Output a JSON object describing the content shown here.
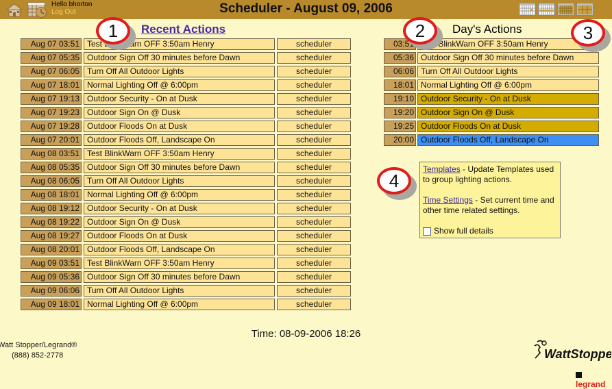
{
  "header": {
    "title": "Scheduler - August 09, 2006",
    "greeting": "Hello bhorton",
    "logout_label": "Log Out",
    "view_buttons": [
      "day-view",
      "week-view",
      "month-view",
      "year-view"
    ]
  },
  "recent": {
    "title": "Recent Actions",
    "rows": [
      {
        "date": "Aug 07 03:51",
        "action": "Test BlinkWarn OFF 3:50am Henry",
        "user": "scheduler"
      },
      {
        "date": "Aug 07 05:35",
        "action": "Outdoor Sign Off 30 minutes before Dawn",
        "user": "scheduler"
      },
      {
        "date": "Aug 07 06:05",
        "action": "Turn Off All Outdoor Lights",
        "user": "scheduler"
      },
      {
        "date": "Aug 07 18:01",
        "action": "Normal Lighting Off @ 6:00pm",
        "user": "scheduler"
      },
      {
        "date": "Aug 07 19:13",
        "action": "Outdoor Security - On at Dusk",
        "user": "scheduler"
      },
      {
        "date": "Aug 07 19:23",
        "action": "Outdoor Sign On @ Dusk",
        "user": "scheduler"
      },
      {
        "date": "Aug 07 19:28",
        "action": "Outdoor Floods On at Dusk",
        "user": "scheduler"
      },
      {
        "date": "Aug 07 20:01",
        "action": "Outdoor Floods Off, Landscape On",
        "user": "scheduler"
      },
      {
        "date": "Aug 08 03:51",
        "action": "Test BlinkWarn OFF 3:50am Henry",
        "user": "scheduler"
      },
      {
        "date": "Aug 08 05:35",
        "action": "Outdoor Sign Off 30 minutes before Dawn",
        "user": "scheduler"
      },
      {
        "date": "Aug 08 06:05",
        "action": "Turn Off All Outdoor Lights",
        "user": "scheduler"
      },
      {
        "date": "Aug 08 18:01",
        "action": "Normal Lighting Off @ 6:00pm",
        "user": "scheduler"
      },
      {
        "date": "Aug 08 19:12",
        "action": "Outdoor Security - On at Dusk",
        "user": "scheduler"
      },
      {
        "date": "Aug 08 19:22",
        "action": "Outdoor Sign On @ Dusk",
        "user": "scheduler"
      },
      {
        "date": "Aug 08 19:27",
        "action": "Outdoor Floods On at Dusk",
        "user": "scheduler"
      },
      {
        "date": "Aug 08 20:01",
        "action": "Outdoor Floods Off, Landscape On",
        "user": "scheduler"
      },
      {
        "date": "Aug 09 03:51",
        "action": "Test BlinkWarn OFF 3:50am Henry",
        "user": "scheduler"
      },
      {
        "date": "Aug 09 05:36",
        "action": "Outdoor Sign Off 30 minutes before Dawn",
        "user": "scheduler"
      },
      {
        "date": "Aug 09 06:06",
        "action": "Turn Off All Outdoor Lights",
        "user": "scheduler"
      },
      {
        "date": "Aug 09 18:01",
        "action": "Normal Lighting Off @ 6:00pm",
        "user": "scheduler"
      }
    ]
  },
  "day": {
    "title": "Day's Actions",
    "rows": [
      {
        "time": "03:51",
        "action": "Test BlinkWarn OFF 3:50am Henry",
        "status": "past"
      },
      {
        "time": "05:36",
        "action": "Outdoor Sign Off 30 minutes before Dawn",
        "status": "past"
      },
      {
        "time": "06:06",
        "action": "Turn Off All Outdoor Lights",
        "status": "past"
      },
      {
        "time": "18:01",
        "action": "Normal Lighting Off @ 6:00pm",
        "status": "past"
      },
      {
        "time": "19:10",
        "action": "Outdoor Security - On at Dusk",
        "status": "upcoming"
      },
      {
        "time": "19:20",
        "action": "Outdoor Sign On @ Dusk",
        "status": "upcoming"
      },
      {
        "time": "19:25",
        "action": "Outdoor Floods On at Dusk",
        "status": "upcoming"
      },
      {
        "time": "20:00",
        "action": "Outdoor Floods Off, Landscape On",
        "status": "next"
      }
    ],
    "status_colors": {
      "past": "#fde396",
      "upcoming": "#d4ac00",
      "next": "#3d8ff2"
    }
  },
  "info": {
    "templates_link": "Templates",
    "templates_text": " - Update Templates used to group lighting actions.",
    "time_settings_link": "Time Settings",
    "time_settings_text": " - Set current time and other time related settings.",
    "show_details_label": "Show full details",
    "show_details_checked": false
  },
  "footer": {
    "time_readout": "Time: 08-09-2006 18:26",
    "company": "Watt Stopper/Legrand®",
    "phone": "(888) 852-2778",
    "logo_text": "WattStopper",
    "legrand_text": "legrand"
  },
  "callouts": [
    "1",
    "2",
    "3",
    "4"
  ]
}
